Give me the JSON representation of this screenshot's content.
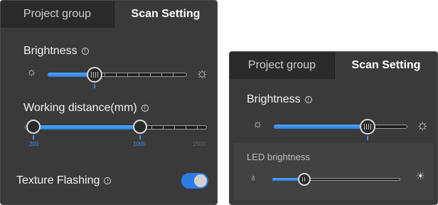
{
  "panel_left": {
    "tabs": [
      {
        "label": "Project group"
      },
      {
        "label": "Scan Setting"
      }
    ],
    "brightness": {
      "label": "Brightness",
      "value_fraction": 0.34
    },
    "working_distance": {
      "label": "Working distance(mm)",
      "range_start": 200,
      "range_end": 1000,
      "scale_labels": [
        "200",
        "1000",
        "1500"
      ]
    },
    "texture_flashing": {
      "label": "Texture Flashing",
      "enabled": true
    }
  },
  "panel_right": {
    "tabs": [
      {
        "label": "Project group"
      },
      {
        "label": "Scan Setting"
      }
    ],
    "brightness": {
      "label": "Brightness",
      "value_fraction": 0.7
    },
    "led_brightness": {
      "label": "LED brightness",
      "value_fraction": 0.22
    }
  },
  "icons": {
    "info": "info-icon",
    "sun_small": "sun-small-icon",
    "sun_large": "sun-large-icon",
    "bulb_off": "bulb-off-icon",
    "bulb_on": "bulb-on-icon"
  },
  "colors": {
    "accent": "#2c7ce5",
    "panel_bg": "#3a3a3a",
    "tab_inactive_bg": "#2a2a2a"
  }
}
